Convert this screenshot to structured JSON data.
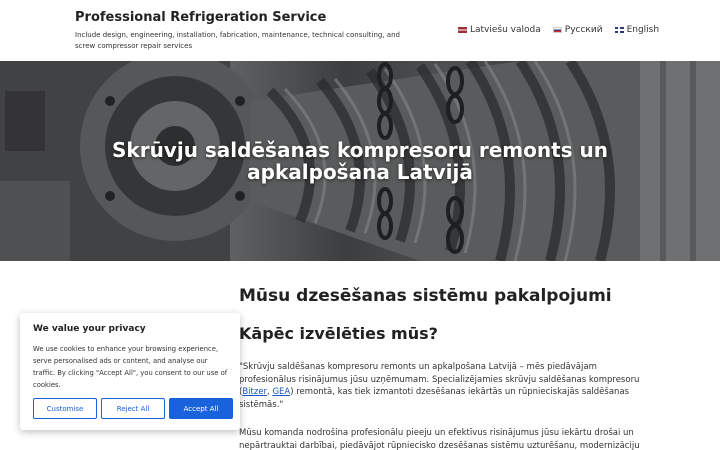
{
  "header": {
    "site_title": "Professional Refrigeration Service",
    "site_description": "Include design, engineering, installation, fabrication, maintenance, technical consulting, and screw compressor repair services",
    "languages": [
      {
        "label": "Latviešu valoda",
        "flag": "latvia-flag-icon"
      },
      {
        "label": "Русский",
        "flag": "russia-flag-icon"
      },
      {
        "label": "English",
        "flag": "uk-flag-icon"
      }
    ]
  },
  "hero": {
    "title": "Skrūvju saldēšanas kompresoru remonts un apkalpošana Latvijā"
  },
  "content": {
    "heading": "Mūsu dzesēšanas sistēmu pakalpojumi",
    "subheading": "Kāpēc izvēlēties mūs?",
    "para1_before": "\"Skrūvju saldēšanas kompresoru remonts un apkalpošana Latvijā – mēs piedāvājam profesionālus risinājumus jūsu uzņēmumam. Specializējamies skrūvju saldēšanas kompresoru (",
    "link_bitzer": "Bitzer",
    "para1_comma": ", ",
    "link_gea": "GEA",
    "para1_after": ") remontā, kas tiek izmantoti dzesēšanas iekārtās un rūpnieciskajās saldēšanas sistēmās.\"",
    "para2": "Mūsu komanda nodrošina profesionālu pieeju un efektīvus risinājumus jūsu iekārtu drošai un nepārtrauktai darbībai, piedāvājot rūpniecisko dzesēšanas sistēmu uzturēšanu, modernizāciju un projektu izstrādi."
  },
  "cookie": {
    "title": "We value your privacy",
    "text": "We use cookies to enhance your browsing experience, serve personalised ads or content, and analyse our traffic. By clicking \"Accept All\", you consent to our use of cookies.",
    "customise": "Customise",
    "reject": "Reject All",
    "accept": "Accept All"
  },
  "colors": {
    "accent": "#1863dc",
    "link": "#1a55c4"
  }
}
